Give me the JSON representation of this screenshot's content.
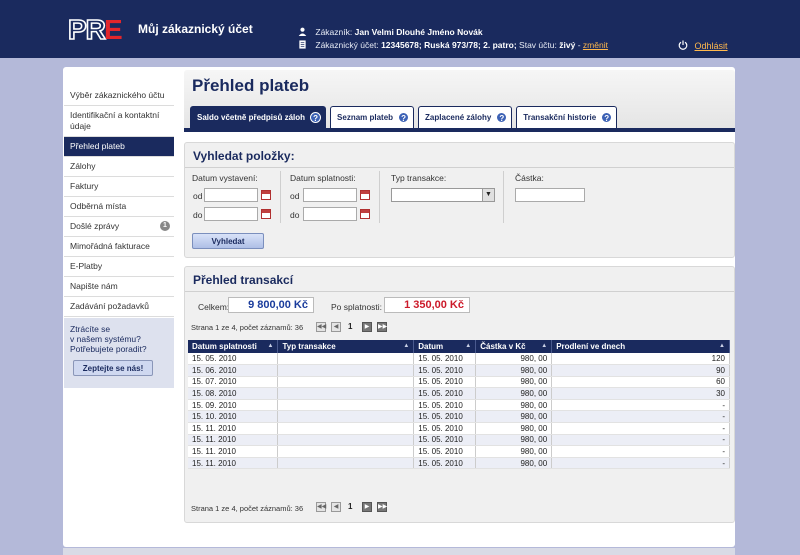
{
  "header": {
    "logo_text": "PRE",
    "title": "Můj zákaznický účet",
    "customer_label": "Zákazník:",
    "customer_name": "Jan Velmi Dlouhé Jméno Novák",
    "account_label": "Zákaznický účet:",
    "account_info": "12345678; Ruská 973/78; 2. patro;",
    "status_label": "Stav účtu:",
    "status_value": "živý",
    "status_sep": "-",
    "change_link": "změnit",
    "logout": "Odhlásit",
    "icons": [
      "user-icon",
      "document-icon",
      "power-icon"
    ]
  },
  "sidebar": {
    "items": [
      {
        "label": "Výběr zákaznického účtu"
      },
      {
        "label": "Identifikační a kontaktní údaje"
      },
      {
        "label": "Přehled plateb",
        "active": true
      },
      {
        "label": "Zálohy"
      },
      {
        "label": "Faktury"
      },
      {
        "label": "Odběrná místa"
      },
      {
        "label": "Došlé zprávy",
        "badge": "1"
      },
      {
        "label": "Mimořádná fakturace"
      },
      {
        "label": "E-Platby"
      },
      {
        "label": "Napište nám"
      },
      {
        "label": "Zadávání požadavků"
      }
    ],
    "help_text_1": "Ztrácíte se",
    "help_text_2": "v našem systému?",
    "help_text_3": "Potřebujete poradit?",
    "help_button": "Zeptejte se nás!"
  },
  "main": {
    "title": "Přehled plateb",
    "tabs": [
      {
        "label": "Saldo včetně předpisů záloh",
        "active": true
      },
      {
        "label": "Seznam plateb"
      },
      {
        "label": "Zaplacené zálohy"
      },
      {
        "label": "Transakční historie"
      }
    ],
    "tab_help_icon": "?"
  },
  "search": {
    "title": "Vyhledat položky:",
    "issue_date_label": "Datum vystavení:",
    "due_date_label": "Datum splatnosti:",
    "type_label": "Typ transakce:",
    "amount_label": "Částka:",
    "from_label": "od",
    "to_label": "do",
    "button": "Vyhledat"
  },
  "transactions": {
    "title": "Přehled transakcí",
    "total_label": "Celkem:",
    "total_value": "9 800,00 Kč",
    "overdue_label": "Po splatnosti:",
    "overdue_value": "1 350,00 Kč",
    "pager_text": "Strana 1 ze 4, počet záznamů: 36",
    "current_page": "1",
    "columns": [
      "Datum splatnosti",
      "Typ transakce",
      "Datum",
      "Částka v Kč",
      "Prodlení ve dnech"
    ],
    "sort_icon": "▲",
    "rows": [
      [
        "15. 05. 2010",
        "",
        "15. 05. 2010",
        "980, 00",
        "120"
      ],
      [
        "15. 06. 2010",
        "",
        "15. 05. 2010",
        "980, 00",
        "90"
      ],
      [
        "15. 07. 2010",
        "",
        "15. 05. 2010",
        "980, 00",
        "60"
      ],
      [
        "15. 08. 2010",
        "",
        "15. 05. 2010",
        "980, 00",
        "30"
      ],
      [
        "15. 09. 2010",
        "",
        "15. 05. 2010",
        "980, 00",
        "-"
      ],
      [
        "15. 10. 2010",
        "",
        "15. 05. 2010",
        "980, 00",
        "-"
      ],
      [
        "15. 11. 2010",
        "",
        "15. 05. 2010",
        "980, 00",
        "-"
      ],
      [
        "15. 11. 2010",
        "",
        "15. 05. 2010",
        "980, 00",
        "-"
      ],
      [
        "15. 11. 2010",
        "",
        "15. 05. 2010",
        "980, 00",
        "-"
      ],
      [
        "15. 11. 2010",
        "",
        "15. 05. 2010",
        "980, 00",
        "-"
      ]
    ]
  },
  "colors": {
    "brand_navy": "#1a2a5e",
    "brand_red": "#e3262b",
    "link_orange": "#ffb84d",
    "total_blue": "#1a3c9c",
    "overdue_red": "#cc1a2a"
  }
}
